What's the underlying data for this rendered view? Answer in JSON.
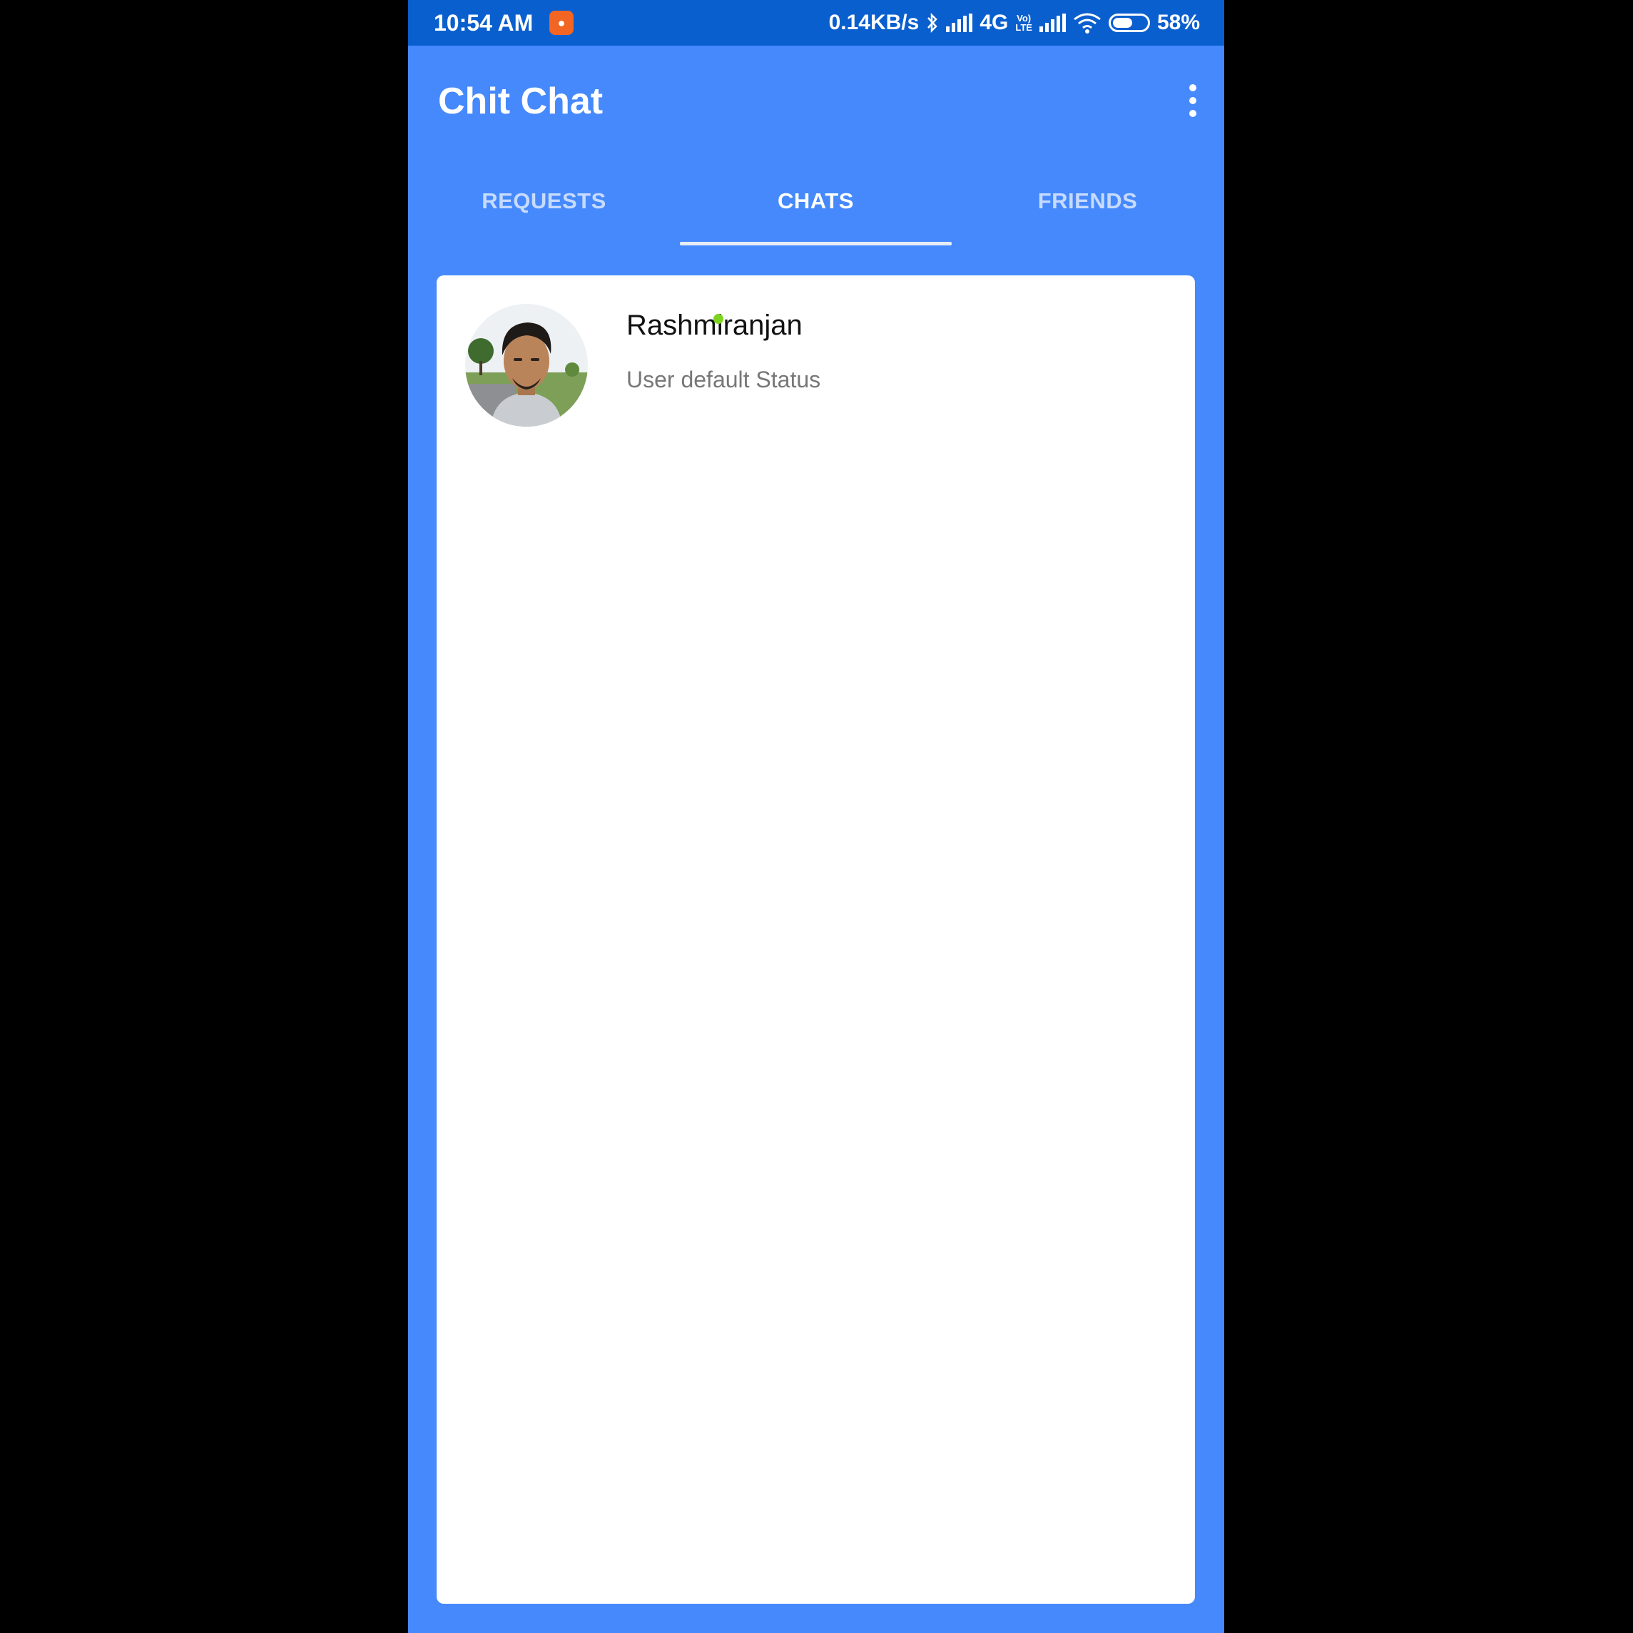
{
  "status_bar": {
    "time": "10:54 AM",
    "network_speed": "0.14KB/s",
    "network_type": "4G",
    "volte_line1": "Vo)",
    "volte_line2": "LTE",
    "battery_text": "58%",
    "battery_level": 0.58,
    "icons": [
      "notification-app-icon",
      "bluetooth-icon",
      "signal-icon",
      "signal-icon",
      "wifi-icon",
      "battery-icon"
    ]
  },
  "app_bar": {
    "title": "Chit Chat",
    "menu_icon": "more-vert-icon"
  },
  "tabs": [
    {
      "label": "REQUESTS",
      "active": false
    },
    {
      "label": "CHATS",
      "active": true
    },
    {
      "label": "FRIENDS",
      "active": false
    }
  ],
  "chats": [
    {
      "name": "Rashmiranjan",
      "status": "User default Status",
      "online": true
    }
  ],
  "colors": {
    "status_bar": "#0a5fce",
    "primary": "#4589fc",
    "tab_inactive": "#c7dbff",
    "online": "#7ed321"
  }
}
